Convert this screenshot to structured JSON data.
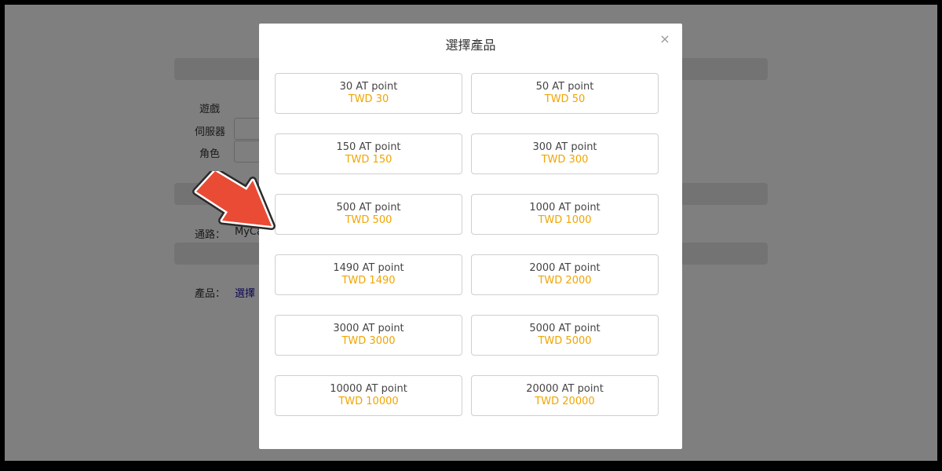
{
  "background_page": {
    "labels": {
      "game": "遊戲",
      "server": "伺服器",
      "character": "角色",
      "channel": "通路：",
      "product": "產品："
    },
    "channel_value": "MyCa",
    "product_link": "選擇"
  },
  "modal": {
    "title": "選擇產品",
    "close_symbol": "×",
    "products": [
      {
        "name": "30 AT point",
        "price": "TWD 30"
      },
      {
        "name": "50 AT point",
        "price": "TWD 50"
      },
      {
        "name": "150 AT point",
        "price": "TWD 150"
      },
      {
        "name": "300 AT point",
        "price": "TWD 300"
      },
      {
        "name": "500 AT point",
        "price": "TWD 500"
      },
      {
        "name": "1000 AT point",
        "price": "TWD 1000"
      },
      {
        "name": "1490 AT point",
        "price": "TWD 1490"
      },
      {
        "name": "2000 AT point",
        "price": "TWD 2000"
      },
      {
        "name": "3000 AT point",
        "price": "TWD 3000"
      },
      {
        "name": "5000 AT point",
        "price": "TWD 5000"
      },
      {
        "name": "10000 AT point",
        "price": "TWD 10000"
      },
      {
        "name": "20000 AT point",
        "price": "TWD 20000"
      }
    ]
  },
  "colors": {
    "price_accent": "#f0a500",
    "arrow_fill": "#ea4b35"
  },
  "icons": {
    "close": "close-icon",
    "pointer": "pointer-arrow-icon"
  }
}
